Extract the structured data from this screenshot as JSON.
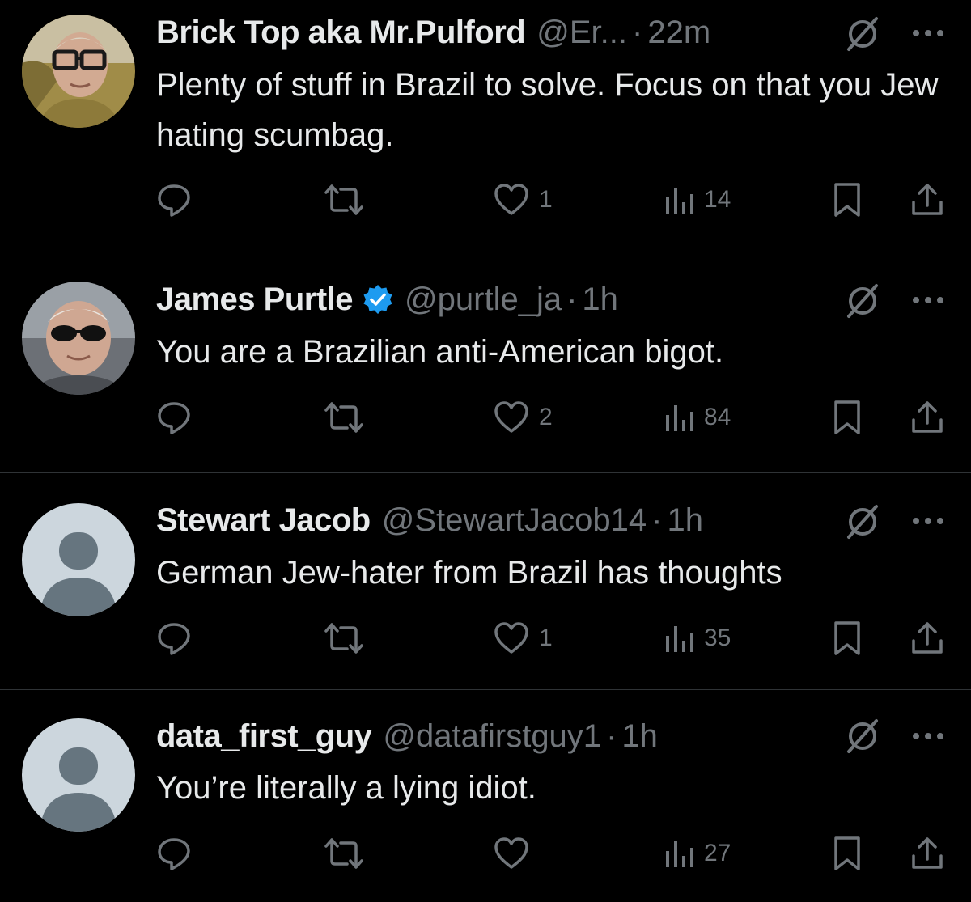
{
  "colors": {
    "background": "#000000",
    "text_primary": "#e7e9ea",
    "text_secondary": "#71767b",
    "verified_blue": "#1d9bf0",
    "divider": "#2f3336"
  },
  "tweets": [
    {
      "name": "Brick Top aka Mr.Pulford",
      "verified": false,
      "handle": "@Er...",
      "time": "22m",
      "text": "Plenty of stuff in Brazil to solve. Focus on that you Jew hating scumbag.",
      "likes": "1",
      "views": "14",
      "avatar": "photo-older-man-glasses"
    },
    {
      "name": "James Purtle",
      "verified": true,
      "handle": "@purtle_ja",
      "time": "1h",
      "text": "You are a Brazilian anti-American bigot.",
      "likes": "2",
      "views": "84",
      "avatar": "photo-man-sunglasses"
    },
    {
      "name": "Stewart Jacob",
      "verified": false,
      "handle": "@StewartJacob14",
      "time": "1h",
      "text": "German Jew-hater from Brazil has thoughts",
      "likes": "1",
      "views": "35",
      "avatar": "default-avatar"
    },
    {
      "name": "data_first_guy",
      "verified": false,
      "handle": "@datafirstguy1",
      "time": "1h",
      "text": "You’re literally a lying idiot.",
      "likes": "",
      "views": "27",
      "avatar": "default-avatar"
    }
  ],
  "separator": "·",
  "icons": {
    "reply": "reply-icon",
    "retweet": "retweet-icon",
    "like": "like-icon",
    "views": "views-icon",
    "bookmark": "bookmark-icon",
    "share": "share-icon",
    "grok": "grok-icon",
    "more": "more-icon"
  }
}
